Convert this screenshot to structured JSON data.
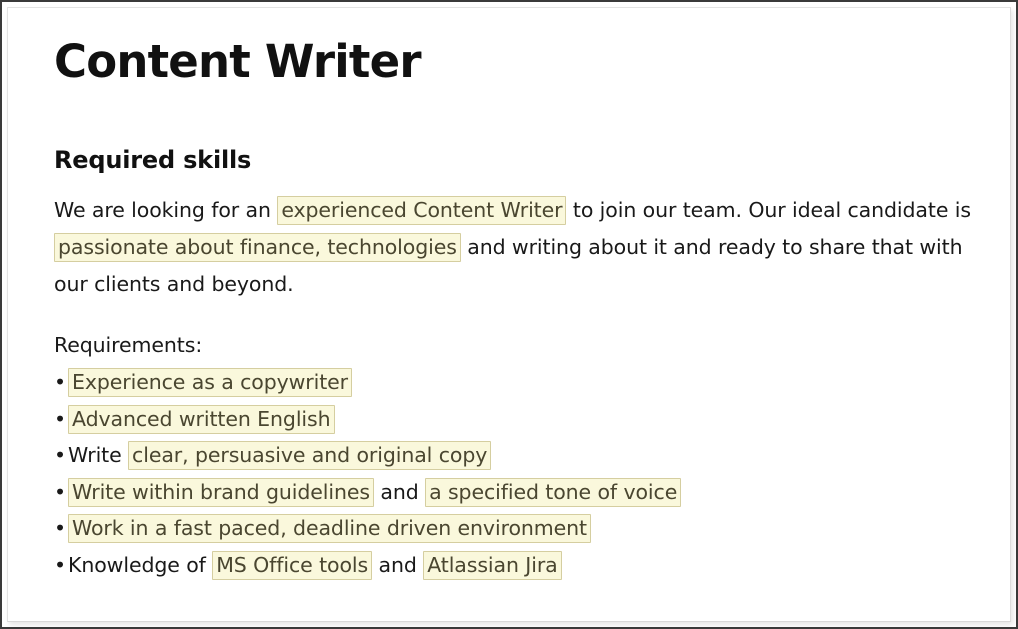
{
  "document": {
    "title": "Content Writer",
    "section_heading": "Required skills",
    "intro": {
      "segments": [
        {
          "text": "We are looking for an ",
          "highlight": false
        },
        {
          "text": "experienced Content Writer",
          "highlight": true
        },
        {
          "text": " to join our team. Our ideal candidate is ",
          "highlight": false
        },
        {
          "text": "passionate about finance, technologies",
          "highlight": true
        },
        {
          "text": " and writing about it and ready to share that with our clients and beyond.",
          "highlight": false
        }
      ],
      "plain_text": "We are looking for an experienced Content Writer to join our team. Our ideal candidate is passionate about finance, technologies and writing about it and ready to share that with our clients and beyond."
    },
    "requirements_label": "Requirements:",
    "bullet_marker": "•",
    "requirements": [
      {
        "segments": [
          {
            "text": "Experience as a copywriter",
            "highlight": true
          }
        ]
      },
      {
        "segments": [
          {
            "text": "Advanced written English",
            "highlight": true
          }
        ]
      },
      {
        "segments": [
          {
            "text": "Write ",
            "highlight": false
          },
          {
            "text": "clear, persuasive and original copy",
            "highlight": true
          }
        ]
      },
      {
        "segments": [
          {
            "text": "Write within brand guidelines",
            "highlight": true
          },
          {
            "text": " and ",
            "highlight": false
          },
          {
            "text": "a specified tone of voice",
            "highlight": true
          }
        ]
      },
      {
        "segments": [
          {
            "text": "Work in a fast paced, deadline driven environment",
            "highlight": true
          }
        ]
      },
      {
        "segments": [
          {
            "text": "Knowledge of ",
            "highlight": false
          },
          {
            "text": "MS Office tools",
            "highlight": true
          },
          {
            "text": " and ",
            "highlight": false
          },
          {
            "text": "Atlassian Jira",
            "highlight": true
          }
        ]
      }
    ]
  },
  "theme": {
    "page_background": "#ffffff",
    "frame_border": "#3a3a3a",
    "text_color": "#191919",
    "highlight_background": "#faf8dc",
    "highlight_border": "#d5cea0",
    "highlight_text": "#4a4630"
  }
}
